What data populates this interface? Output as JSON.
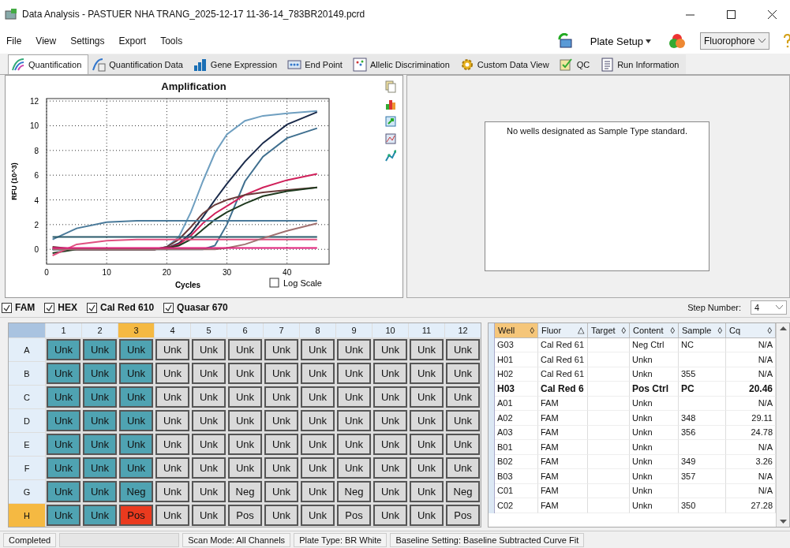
{
  "window": {
    "title": "Data Analysis - PASTUER NHA TRANG_2025-12-17 11-36-14_783BR20149.pcrd"
  },
  "menu": [
    "File",
    "View",
    "Settings",
    "Export",
    "Tools"
  ],
  "toolbar": {
    "plate_setup": "Plate Setup",
    "fluorophore": "Fluorophore"
  },
  "tabs": [
    {
      "label": "Quantification",
      "selected": true
    },
    {
      "label": "Quantification Data",
      "selected": false
    },
    {
      "label": "Gene Expression",
      "selected": false
    },
    {
      "label": "End Point",
      "selected": false
    },
    {
      "label": "Allelic Discrimination",
      "selected": false
    },
    {
      "label": "Custom Data View",
      "selected": false
    },
    {
      "label": "QC",
      "selected": false
    },
    {
      "label": "Run Information",
      "selected": false
    }
  ],
  "chart": {
    "log_scale": {
      "label": "Log Scale",
      "checked": false
    },
    "chart_data": {
      "type": "line",
      "title": "Amplification",
      "xlabel": "Cycles",
      "ylabel": "RFU (10^3)",
      "x": [
        1,
        5,
        10,
        15,
        18,
        20,
        22,
        24,
        26,
        28,
        30,
        33,
        36,
        40,
        45
      ],
      "grid": true,
      "xlim": [
        0,
        47
      ],
      "ylim": [
        -1.2,
        12.2
      ],
      "xticks": [
        0,
        10,
        20,
        30,
        40
      ],
      "yticks": [
        0,
        2,
        4,
        6,
        8,
        10,
        12
      ],
      "series": [
        {
          "color": "#6f9fc0",
          "values": [
            0,
            0,
            0,
            0,
            0,
            0.2,
            1.0,
            3.0,
            5.5,
            7.8,
            9.3,
            10.4,
            10.8,
            11.0,
            11.2
          ]
        },
        {
          "color": "#1a2a4a",
          "values": [
            0,
            0,
            0,
            0,
            0,
            0.1,
            0.5,
            1.3,
            2.6,
            4.0,
            5.3,
            7.1,
            8.6,
            10.1,
            11.1
          ]
        },
        {
          "color": "#3f6f8f",
          "values": [
            0,
            0,
            0,
            0,
            0,
            0,
            0,
            0,
            0,
            0.3,
            2.0,
            5.5,
            7.5,
            9.0,
            9.8
          ]
        },
        {
          "color": "#d0205a",
          "values": [
            0.1,
            0,
            0,
            0,
            0,
            0.1,
            0.4,
            1.1,
            2.1,
            2.9,
            3.5,
            4.4,
            5.0,
            5.6,
            6.1
          ]
        },
        {
          "color": "#6a3a3a",
          "values": [
            0.2,
            0,
            0,
            0,
            0,
            0.2,
            0.8,
            1.8,
            2.9,
            3.6,
            4.0,
            4.4,
            4.6,
            4.8,
            5.0
          ]
        },
        {
          "color": "#1f3a1f",
          "values": [
            -0.3,
            0,
            0,
            0,
            0,
            0.1,
            0.3,
            0.8,
            1.6,
            2.4,
            3.0,
            3.7,
            4.3,
            4.7,
            5.0
          ]
        },
        {
          "color": "#4a7a9a",
          "values": [
            0.8,
            1.7,
            2.2,
            2.3,
            2.3,
            2.3,
            2.3,
            2.3,
            2.3,
            2.3,
            2.3,
            2.3,
            2.3,
            2.3,
            2.3
          ]
        },
        {
          "color": "#2a5a6a",
          "values": [
            1,
            1,
            1,
            1,
            1,
            1,
            1,
            1,
            1,
            1,
            1,
            1,
            1,
            1,
            1
          ]
        },
        {
          "color": "#e05080",
          "values": [
            -0.5,
            0.4,
            0.7,
            0.8,
            0.8,
            0.8,
            0.8,
            0.8,
            0.8,
            0.8,
            0.8,
            0.8,
            0.8,
            0.8,
            0.8
          ]
        },
        {
          "color": "#a07070",
          "values": [
            0,
            0,
            0,
            0,
            0,
            0,
            0,
            0,
            0,
            0,
            0.1,
            0.4,
            0.9,
            1.5,
            2.1
          ]
        },
        {
          "color": "#e0207a",
          "values": [
            0.1,
            0.1,
            0.1,
            0.1,
            0.1,
            0.1,
            0.1,
            0.1,
            0.1,
            0.1,
            0.1,
            0.1,
            0.1,
            0.1,
            0.1
          ]
        }
      ]
    }
  },
  "standard_panel": {
    "message": "No wells designated as Sample Type standard."
  },
  "fluorophores": [
    {
      "label": "FAM",
      "checked": true
    },
    {
      "label": "HEX",
      "checked": true
    },
    {
      "label": "Cal Red 610",
      "checked": true
    },
    {
      "label": "Quasar 670",
      "checked": true
    }
  ],
  "step_number": {
    "label": "Step Number:",
    "value": "4"
  },
  "plate": {
    "columns": [
      {
        "label": "1",
        "selected": false
      },
      {
        "label": "2",
        "selected": false
      },
      {
        "label": "3",
        "selected": true
      },
      {
        "label": "4",
        "selected": false
      },
      {
        "label": "5",
        "selected": false
      },
      {
        "label": "6",
        "selected": false
      },
      {
        "label": "7",
        "selected": false
      },
      {
        "label": "8",
        "selected": false
      },
      {
        "label": "9",
        "selected": false
      },
      {
        "label": "10",
        "selected": false
      },
      {
        "label": "11",
        "selected": false
      },
      {
        "label": "12",
        "selected": false
      }
    ],
    "rows": [
      {
        "label": "A",
        "selected": false,
        "wells": [
          {
            "text": "Unk",
            "color": "#4fa3b2"
          },
          {
            "text": "Unk",
            "color": "#4fa3b2"
          },
          {
            "text": "Unk",
            "color": "#4fa3b2"
          },
          {
            "text": "Unk",
            "color": "#dadada"
          },
          {
            "text": "Unk",
            "color": "#dadada"
          },
          {
            "text": "Unk",
            "color": "#dadada"
          },
          {
            "text": "Unk",
            "color": "#dadada"
          },
          {
            "text": "Unk",
            "color": "#dadada"
          },
          {
            "text": "Unk",
            "color": "#dadada"
          },
          {
            "text": "Unk",
            "color": "#dadada"
          },
          {
            "text": "Unk",
            "color": "#dadada"
          },
          {
            "text": "Unk",
            "color": "#dadada"
          }
        ]
      },
      {
        "label": "B",
        "selected": false,
        "wells": [
          {
            "text": "Unk",
            "color": "#4fa3b2"
          },
          {
            "text": "Unk",
            "color": "#4fa3b2"
          },
          {
            "text": "Unk",
            "color": "#4fa3b2"
          },
          {
            "text": "Unk",
            "color": "#dadada"
          },
          {
            "text": "Unk",
            "color": "#dadada"
          },
          {
            "text": "Unk",
            "color": "#dadada"
          },
          {
            "text": "Unk",
            "color": "#dadada"
          },
          {
            "text": "Unk",
            "color": "#dadada"
          },
          {
            "text": "Unk",
            "color": "#dadada"
          },
          {
            "text": "Unk",
            "color": "#dadada"
          },
          {
            "text": "Unk",
            "color": "#dadada"
          },
          {
            "text": "Unk",
            "color": "#dadada"
          }
        ]
      },
      {
        "label": "C",
        "selected": false,
        "wells": [
          {
            "text": "Unk",
            "color": "#4fa3b2"
          },
          {
            "text": "Unk",
            "color": "#4fa3b2"
          },
          {
            "text": "Unk",
            "color": "#4fa3b2"
          },
          {
            "text": "Unk",
            "color": "#dadada"
          },
          {
            "text": "Unk",
            "color": "#dadada"
          },
          {
            "text": "Unk",
            "color": "#dadada"
          },
          {
            "text": "Unk",
            "color": "#dadada"
          },
          {
            "text": "Unk",
            "color": "#dadada"
          },
          {
            "text": "Unk",
            "color": "#dadada"
          },
          {
            "text": "Unk",
            "color": "#dadada"
          },
          {
            "text": "Unk",
            "color": "#dadada"
          },
          {
            "text": "Unk",
            "color": "#dadada"
          }
        ]
      },
      {
        "label": "D",
        "selected": false,
        "wells": [
          {
            "text": "Unk",
            "color": "#4fa3b2"
          },
          {
            "text": "Unk",
            "color": "#4fa3b2"
          },
          {
            "text": "Unk",
            "color": "#4fa3b2"
          },
          {
            "text": "Unk",
            "color": "#dadada"
          },
          {
            "text": "Unk",
            "color": "#dadada"
          },
          {
            "text": "Unk",
            "color": "#dadada"
          },
          {
            "text": "Unk",
            "color": "#dadada"
          },
          {
            "text": "Unk",
            "color": "#dadada"
          },
          {
            "text": "Unk",
            "color": "#dadada"
          },
          {
            "text": "Unk",
            "color": "#dadada"
          },
          {
            "text": "Unk",
            "color": "#dadada"
          },
          {
            "text": "Unk",
            "color": "#dadada"
          }
        ]
      },
      {
        "label": "E",
        "selected": false,
        "wells": [
          {
            "text": "Unk",
            "color": "#4fa3b2"
          },
          {
            "text": "Unk",
            "color": "#4fa3b2"
          },
          {
            "text": "Unk",
            "color": "#4fa3b2"
          },
          {
            "text": "Unk",
            "color": "#dadada"
          },
          {
            "text": "Unk",
            "color": "#dadada"
          },
          {
            "text": "Unk",
            "color": "#dadada"
          },
          {
            "text": "Unk",
            "color": "#dadada"
          },
          {
            "text": "Unk",
            "color": "#dadada"
          },
          {
            "text": "Unk",
            "color": "#dadada"
          },
          {
            "text": "Unk",
            "color": "#dadada"
          },
          {
            "text": "Unk",
            "color": "#dadada"
          },
          {
            "text": "Unk",
            "color": "#dadada"
          }
        ]
      },
      {
        "label": "F",
        "selected": false,
        "wells": [
          {
            "text": "Unk",
            "color": "#4fa3b2"
          },
          {
            "text": "Unk",
            "color": "#4fa3b2"
          },
          {
            "text": "Unk",
            "color": "#4fa3b2"
          },
          {
            "text": "Unk",
            "color": "#dadada"
          },
          {
            "text": "Unk",
            "color": "#dadada"
          },
          {
            "text": "Unk",
            "color": "#dadada"
          },
          {
            "text": "Unk",
            "color": "#dadada"
          },
          {
            "text": "Unk",
            "color": "#dadada"
          },
          {
            "text": "Unk",
            "color": "#dadada"
          },
          {
            "text": "Unk",
            "color": "#dadada"
          },
          {
            "text": "Unk",
            "color": "#dadada"
          },
          {
            "text": "Unk",
            "color": "#dadada"
          }
        ]
      },
      {
        "label": "G",
        "selected": false,
        "wells": [
          {
            "text": "Unk",
            "color": "#4fa3b2"
          },
          {
            "text": "Unk",
            "color": "#4fa3b2"
          },
          {
            "text": "Neg",
            "color": "#4fa3b2"
          },
          {
            "text": "Unk",
            "color": "#dadada"
          },
          {
            "text": "Unk",
            "color": "#dadada"
          },
          {
            "text": "Neg",
            "color": "#dadada"
          },
          {
            "text": "Unk",
            "color": "#dadada"
          },
          {
            "text": "Unk",
            "color": "#dadada"
          },
          {
            "text": "Neg",
            "color": "#dadada"
          },
          {
            "text": "Unk",
            "color": "#dadada"
          },
          {
            "text": "Unk",
            "color": "#dadada"
          },
          {
            "text": "Neg",
            "color": "#dadada"
          }
        ]
      },
      {
        "label": "H",
        "selected": true,
        "wells": [
          {
            "text": "Unk",
            "color": "#4fa3b2"
          },
          {
            "text": "Unk",
            "color": "#4fa3b2"
          },
          {
            "text": "Pos",
            "color": "#ea3a1e"
          },
          {
            "text": "Unk",
            "color": "#dadada"
          },
          {
            "text": "Unk",
            "color": "#dadada"
          },
          {
            "text": "Pos",
            "color": "#dadada"
          },
          {
            "text": "Unk",
            "color": "#dadada"
          },
          {
            "text": "Unk",
            "color": "#dadada"
          },
          {
            "text": "Pos",
            "color": "#dadada"
          },
          {
            "text": "Unk",
            "color": "#dadada"
          },
          {
            "text": "Unk",
            "color": "#dadada"
          },
          {
            "text": "Pos",
            "color": "#dadada"
          }
        ]
      }
    ]
  },
  "results": {
    "columns": [
      {
        "label": "Well",
        "sort": "◊",
        "selected": true
      },
      {
        "label": "Fluor",
        "sort": "△",
        "selected": false
      },
      {
        "label": "Target",
        "sort": "◊",
        "selected": false
      },
      {
        "label": "Content",
        "sort": "◊",
        "selected": false
      },
      {
        "label": "Sample",
        "sort": "◊",
        "selected": false
      },
      {
        "label": "Cq",
        "sort": "◊",
        "selected": false
      }
    ],
    "rows": [
      {
        "selected": false,
        "cells": [
          "G03",
          "Cal Red 61",
          "",
          "Neg Ctrl",
          "NC",
          "N/A"
        ]
      },
      {
        "selected": false,
        "cells": [
          "H01",
          "Cal Red 61",
          "",
          "Unkn",
          "",
          "N/A"
        ]
      },
      {
        "selected": false,
        "cells": [
          "H02",
          "Cal Red 61",
          "",
          "Unkn",
          "355",
          "N/A"
        ]
      },
      {
        "selected": true,
        "cells": [
          "H03",
          "Cal Red 6",
          "",
          "Pos Ctrl",
          "PC",
          "20.46"
        ]
      },
      {
        "selected": false,
        "cells": [
          "A01",
          "FAM",
          "",
          "Unkn",
          "",
          "N/A"
        ]
      },
      {
        "selected": false,
        "cells": [
          "A02",
          "FAM",
          "",
          "Unkn",
          "348",
          "29.11"
        ]
      },
      {
        "selected": false,
        "cells": [
          "A03",
          "FAM",
          "",
          "Unkn",
          "356",
          "24.78"
        ]
      },
      {
        "selected": false,
        "cells": [
          "B01",
          "FAM",
          "",
          "Unkn",
          "",
          "N/A"
        ]
      },
      {
        "selected": false,
        "cells": [
          "B02",
          "FAM",
          "",
          "Unkn",
          "349",
          "3.26"
        ]
      },
      {
        "selected": false,
        "cells": [
          "B03",
          "FAM",
          "",
          "Unkn",
          "357",
          "N/A"
        ]
      },
      {
        "selected": false,
        "cells": [
          "C01",
          "FAM",
          "",
          "Unkn",
          "",
          "N/A"
        ]
      },
      {
        "selected": false,
        "cells": [
          "C02",
          "FAM",
          "",
          "Unkn",
          "350",
          "27.28"
        ]
      }
    ]
  },
  "status_bar": {
    "state": "Completed",
    "scan_mode": "Scan Mode: All Channels",
    "plate_type": "Plate Type: BR White",
    "baseline": "Baseline Setting: Baseline Subtracted Curve Fit"
  }
}
